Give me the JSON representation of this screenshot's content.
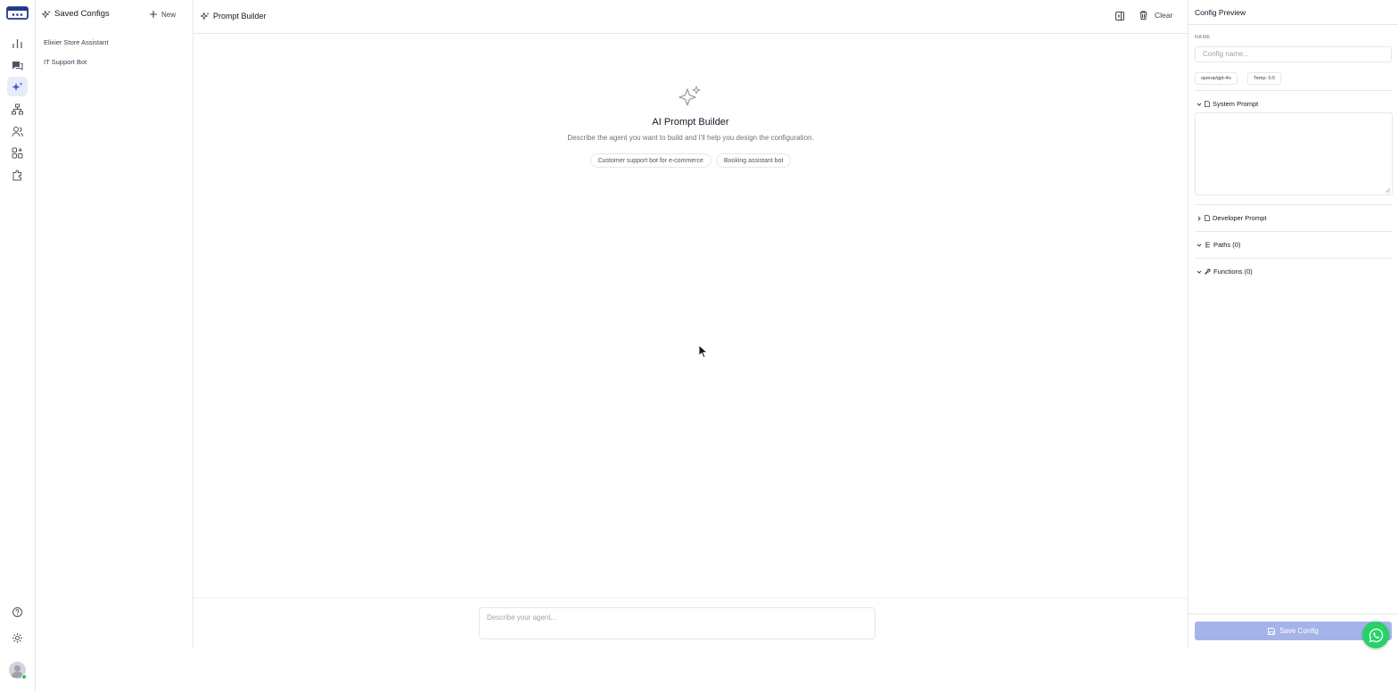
{
  "rail": {
    "icons": [
      "logo-icon",
      "bar-chart-icon",
      "chat-icon",
      "sparkles-icon",
      "sitemap-icon",
      "users-icon",
      "apps-icon",
      "puzzle-icon",
      "help-icon",
      "settings-icon"
    ],
    "active": "sparkles-icon"
  },
  "configs": {
    "title": "Saved Configs",
    "new_label": "New",
    "items": [
      {
        "label": "Elixier Store Assistant"
      },
      {
        "label": "IT Support Bot"
      }
    ]
  },
  "main": {
    "title": "Prompt Builder",
    "clear_label": "Clear",
    "hero_title": "AI Prompt Builder",
    "hero_subtitle": "Describe the agent you want to build and I'll help you design the configuration.",
    "suggestions": [
      {
        "label": "Customer support bot for e-commerce"
      },
      {
        "label": "Booking assistant bot"
      }
    ],
    "composer_placeholder": "Describe your agent..."
  },
  "preview": {
    "title": "Config Preview",
    "name_label": "NAME",
    "name_placeholder": "Config name...",
    "model_badge": "openai/gpt-4o",
    "temp_badge": "Temp: 0.5",
    "sections": {
      "system_prompt": "System Prompt",
      "developer_prompt": "Developer Prompt",
      "paths": "Paths (0)",
      "functions": "Functions (0)"
    },
    "save_label": "Save Config"
  },
  "colors": {
    "accent": "#3b5bdb",
    "save_disabled": "#a5b4e8",
    "whatsapp": "#25d366"
  }
}
